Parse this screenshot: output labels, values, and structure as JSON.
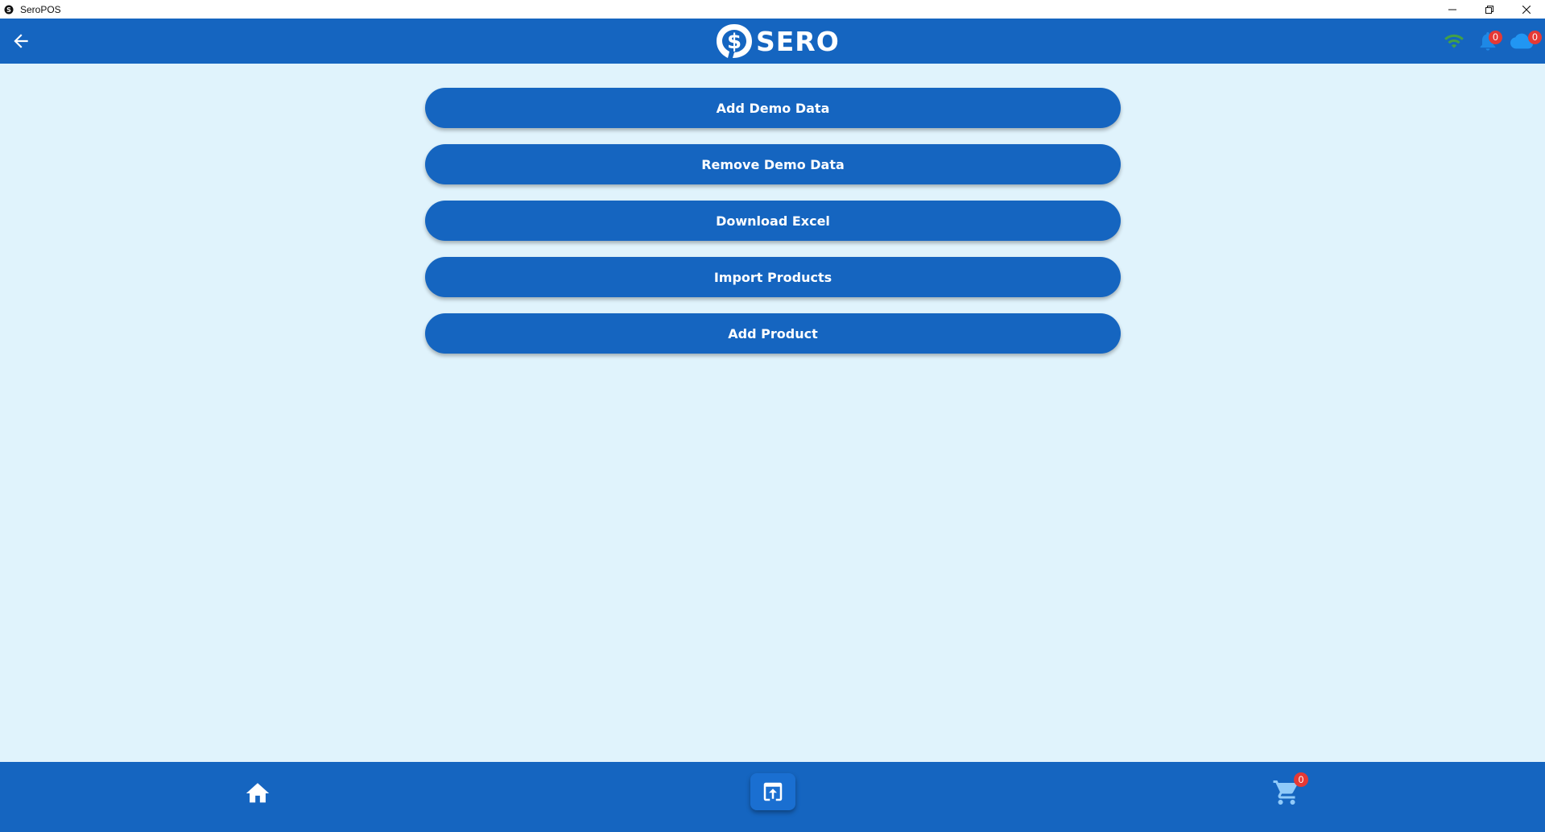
{
  "window": {
    "title": "SeroPOS"
  },
  "header": {
    "logo_text": "SERO",
    "notification_count": "0",
    "sync_count": "0"
  },
  "actions": [
    {
      "label": "Add Demo Data"
    },
    {
      "label": "Remove Demo Data"
    },
    {
      "label": "Download Excel"
    },
    {
      "label": "Import Products"
    },
    {
      "label": "Add Product"
    }
  ],
  "bottom_nav": {
    "cart_count": "0"
  },
  "colors": {
    "primary": "#1565c0",
    "background": "#e0f3fc",
    "wifi": "#43a047",
    "badge": "#e53935"
  },
  "icons": [
    "back-arrow-icon",
    "wifi-icon",
    "bell-icon",
    "cloud-icon",
    "home-icon",
    "upload-screen-icon",
    "cart-icon"
  ]
}
